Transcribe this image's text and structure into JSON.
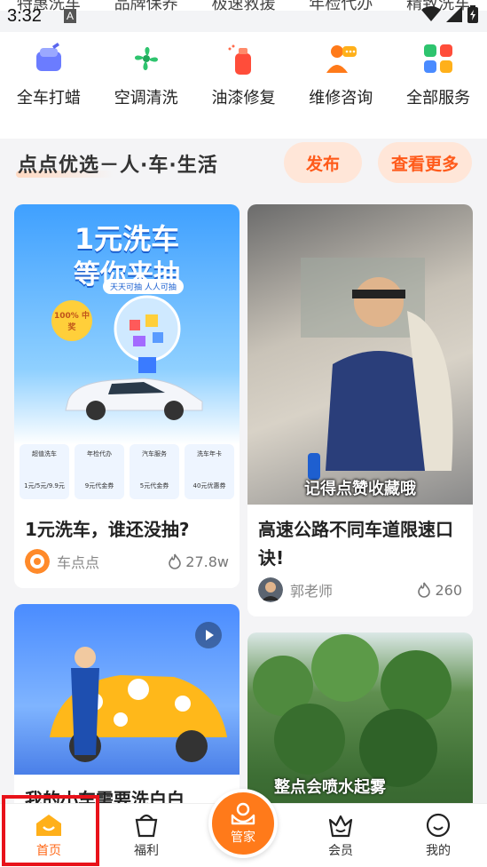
{
  "status_bar": {
    "time": "3:32",
    "a_badge": "A"
  },
  "top_cut_row": [
    "特惠洗车",
    "品牌保养",
    "极速救援",
    "年检代办",
    "精致洗车"
  ],
  "services": [
    {
      "label": "全车打蜡",
      "icon": "wax-icon"
    },
    {
      "label": "空调清洗",
      "icon": "fan-icon"
    },
    {
      "label": "油漆修复",
      "icon": "paint-spray-icon"
    },
    {
      "label": "维修咨询",
      "icon": "consult-icon"
    },
    {
      "label": "全部服务",
      "icon": "all-services-icon"
    }
  ],
  "section": {
    "title": "点点优选－人·车·生活",
    "publish": "发布",
    "more": "查看更多"
  },
  "cards": [
    {
      "title": "1元洗车，谁还没抽?",
      "author": "车点点",
      "likes": "27.8w",
      "image_texts": {
        "headline": "1元洗车",
        "sub": "等你来抽",
        "tag": "天天可抽 人人可抽",
        "badge": "100% 中奖",
        "tiles": [
          "超值洗车",
          "年检代办",
          "汽车服务",
          "洗车年卡"
        ],
        "tile_subs": [
          "1元/5元/9.9元",
          "9元代金券",
          "5元代金券",
          "40元优惠券"
        ]
      }
    },
    {
      "title": "高速公路不同车道限速口诀!",
      "author": "郭老师",
      "likes": "260",
      "image_caption": "记得点赞收藏哦"
    },
    {
      "title": "我的小车需要洗白白"
    },
    {
      "image_caption": "整点会喷水起雾"
    }
  ],
  "nav": [
    {
      "label": "首页",
      "active": true
    },
    {
      "label": "福利"
    },
    {
      "label": "管家"
    },
    {
      "label": "会员"
    },
    {
      "label": "我的"
    }
  ],
  "colors": {
    "accent": "#ff6a1a",
    "highlight": "#e8121a"
  }
}
